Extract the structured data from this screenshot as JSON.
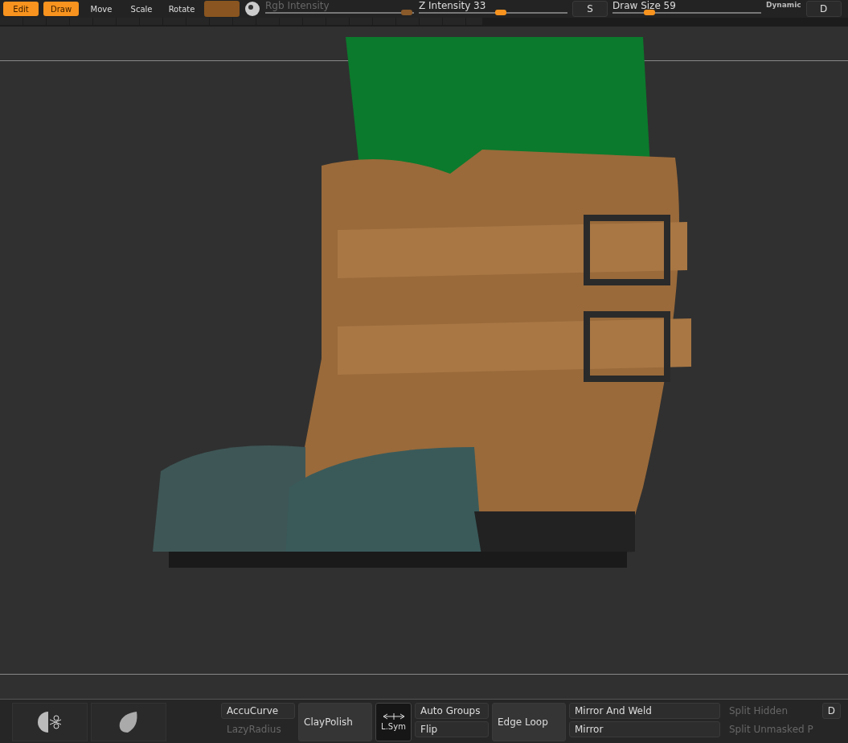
{
  "toolbar": {
    "tools": [
      {
        "label": "Edit",
        "selected": true
      },
      {
        "label": "Draw",
        "selected": true
      },
      {
        "label": "Move",
        "selected": false
      },
      {
        "label": "Scale",
        "selected": false
      },
      {
        "label": "Rotate",
        "selected": false
      }
    ],
    "sliders": [
      {
        "label": "Rgb Intensity",
        "level": 0.95,
        "disabled": true
      },
      {
        "label": "Z Intensity",
        "value": "33",
        "level": 0.55,
        "disabled": false
      }
    ],
    "stroke_button": "S",
    "draw_size": {
      "label": "Draw Size",
      "value": "59",
      "level": 0.25,
      "disabled": false
    },
    "dynamic": "Dynamic",
    "alpha_button": "D"
  },
  "bottom_panel": {
    "columns": [
      {
        "kind": "stack",
        "buttons": [
          {
            "label": "AccuCurve",
            "disabled": false
          },
          {
            "label": "LazyRadius",
            "disabled": true
          }
        ]
      },
      {
        "kind": "tall",
        "label": "ClayPolish"
      },
      {
        "kind": "sym",
        "label": "L.Sym"
      },
      {
        "kind": "stack",
        "buttons": [
          {
            "label": "Auto Groups",
            "disabled": false
          },
          {
            "label": "Flip",
            "disabled": false
          }
        ]
      },
      {
        "kind": "tall",
        "label": "Edge Loop"
      },
      {
        "kind": "wide",
        "buttons": [
          {
            "label": "Mirror And Weld",
            "disabled": false
          },
          {
            "label": "Mirror",
            "disabled": false
          }
        ]
      },
      {
        "kind": "stack",
        "buttons": [
          {
            "label": "Split Hidden",
            "disabled": true
          },
          {
            "label": "Split Unmasked P",
            "disabled": true
          }
        ]
      },
      {
        "kind": "stack",
        "buttons": [
          {
            "label": "D",
            "disabled": false
          }
        ]
      }
    ]
  }
}
